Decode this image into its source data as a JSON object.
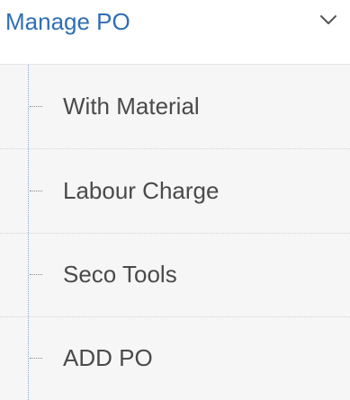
{
  "menu": {
    "title": "Manage PO",
    "expand_icon": "chevron-down-icon",
    "accent_color": "#2f6fb3",
    "items": [
      {
        "label": "With Material"
      },
      {
        "label": "Labour Charge"
      },
      {
        "label": "Seco Tools"
      },
      {
        "label": "ADD PO"
      }
    ]
  }
}
